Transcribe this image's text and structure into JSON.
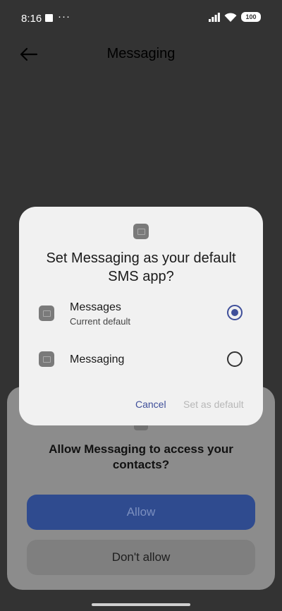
{
  "status_bar": {
    "time": "8:16",
    "dots": "···",
    "battery": "100"
  },
  "header": {
    "title": "Messaging"
  },
  "permission_sheet": {
    "question": "Allow Messaging to access your contacts?",
    "allow_label": "Allow",
    "deny_label": "Don't allow"
  },
  "dialog": {
    "title": "Set Messaging as your default SMS app?",
    "options": [
      {
        "name": "Messages",
        "subtitle": "Current default",
        "selected": true
      },
      {
        "name": "Messaging",
        "subtitle": "",
        "selected": false
      }
    ],
    "cancel_label": "Cancel",
    "set_default_label": "Set as default"
  },
  "colors": {
    "accent": "#3f4f9a",
    "allow_button": "#2f4b8f",
    "dialog_bg": "#f1f1f1"
  }
}
